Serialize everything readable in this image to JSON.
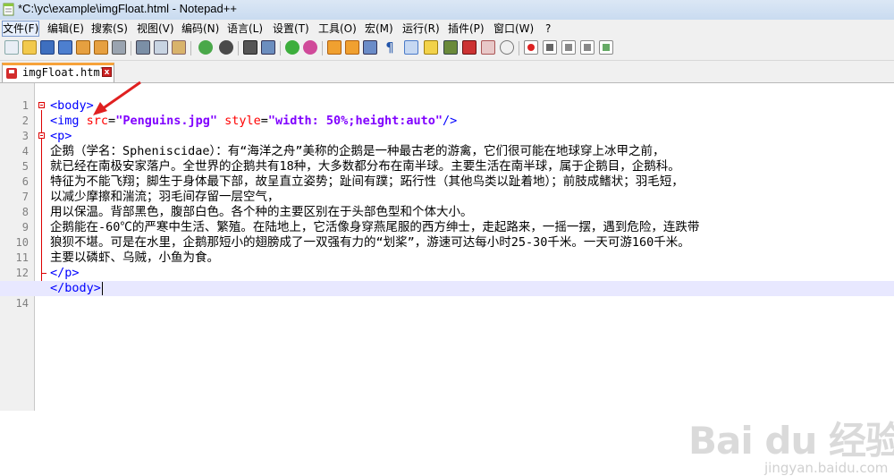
{
  "window": {
    "title": "*C:\\yc\\example\\imgFloat.html - Notepad++"
  },
  "menu": [
    "文件(F)",
    "编辑(E)",
    "搜索(S)",
    "视图(V)",
    "编码(N)",
    "语言(L)",
    "设置(T)",
    "工具(O)",
    "宏(M)",
    "运行(R)",
    "插件(P)",
    "窗口(W)",
    "?"
  ],
  "toolbar_icons": [
    "new-file-icon",
    "open-file-icon",
    "save-icon",
    "save-all-icon",
    "close-icon",
    "close-all-icon",
    "print-icon",
    "cut-icon",
    "copy-icon",
    "paste-icon",
    "undo-icon",
    "redo-icon",
    "find-icon",
    "replace-icon",
    "zoom-in-icon",
    "zoom-out-icon",
    "sync-vertical-icon",
    "sync-horizontal-icon",
    "word-wrap-icon",
    "show-all-chars-icon",
    "indent-guide-icon",
    "user-language-icon",
    "doc-map-icon",
    "function-list-icon",
    "folder-workspace-icon",
    "monitor-icon",
    "record-macro-icon",
    "stop-record-icon",
    "play-macro-icon",
    "run-macro-multiple-icon",
    "save-macro-icon"
  ],
  "tab": {
    "label": "imgFloat.html",
    "close_glyph": "x"
  },
  "editor": {
    "current_line": 14,
    "lines": [
      {
        "n": "1",
        "code": ""
      },
      {
        "n": "2",
        "code": "<body>"
      },
      {
        "n": "3",
        "code": "<img src=\"Penguins.jpg\" style=\"width: 50%;height:auto\"/>"
      },
      {
        "n": "4",
        "code": "<p>"
      },
      {
        "n": "5",
        "code": "企鹅（学名：Spheniscidae）：有“海洋之舟”美称的企鹅是一种最古老的游禽，它们很可能在地球穿上冰甲之前，"
      },
      {
        "n": "6",
        "code": "就已经在南极安家落户。全世界的企鹅共有18种，大多数都分布在南半球。主要生活在南半球，属于企鹅目，企鹅科。"
      },
      {
        "n": "7",
        "code": "特征为不能飞翔；脚生于身体最下部，故呈直立姿势；趾间有蹼；跖行性（其他鸟类以趾着地）；前肢成鳍状；羽毛短，"
      },
      {
        "n": "8",
        "code": "以减少摩擦和湍流；羽毛间存留一层空气，"
      },
      {
        "n": "9",
        "code": "用以保温。背部黑色，腹部白色。各个种的主要区别在于头部色型和个体大小。"
      },
      {
        "n": "10",
        "code": "企鹅能在-60℃的严寒中生活、繁殖。在陆地上，它活像身穿燕尾服的西方绅士，走起路来，一摇一摆，遇到危险，连跌带"
      },
      {
        "n": "11",
        "code": "狼狈不堪。可是在水里，企鹅那短小的翅膀成了一双强有力的“划桨”，游速可达每小时25-30千米。一天可游160千米。"
      },
      {
        "n": "12",
        "code": "主要以磷虾、乌贼，小鱼为食。"
      },
      {
        "n": "13",
        "code": "</p>"
      },
      {
        "n": "14",
        "code": "</body>"
      }
    ]
  },
  "watermark": {
    "logo": "Bai du 经验",
    "sub": "jingyan.baidu.com"
  },
  "colors": {
    "tag": "#0000ff",
    "attribute": "#ff0000",
    "value": "#8000ff",
    "text": "#000000",
    "current_line": "#e8e8ff",
    "annotation_arrow": "#e02020"
  }
}
